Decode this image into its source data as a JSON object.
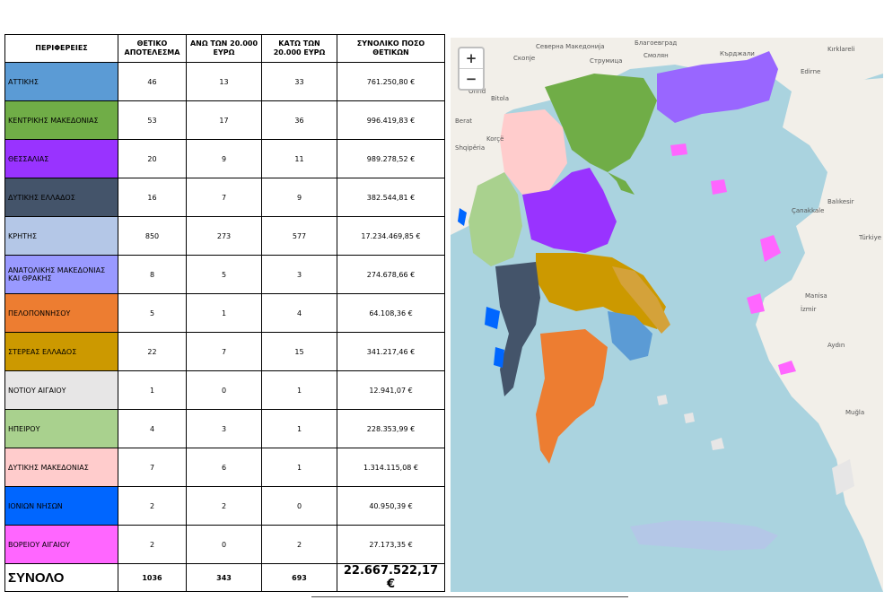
{
  "table": {
    "headers": [
      "ΠΕΡΙΦΕΡΕΙΕΣ",
      "ΘΕΤΙΚΟ ΑΠΟΤΕΛΕΣΜΑ",
      "ΑΝΩ ΤΩΝ 20.000 ΕΥΡΩ",
      "ΚΑΤΩ ΤΩΝ 20.000 ΕΥΡΩ",
      "ΣΥΝΟΛΙΚΟ ΠΟΣΟ ΘΕΤΙΚΩΝ"
    ],
    "rows": [
      {
        "region": "ΑΤΤΙΚΗΣ",
        "color": "#5b9bd5",
        "positive": "46",
        "above": "13",
        "below": "33",
        "total": "761.250,80 €"
      },
      {
        "region": "ΚΕΝΤΡΙΚΗΣ  ΜΑΚΕΔΟΝΙΑΣ",
        "color": "#70ad47",
        "positive": "53",
        "above": "17",
        "below": "36",
        "total": "996.419,83 €"
      },
      {
        "region": "ΘΕΣΣΑΛΙΑΣ",
        "color": "#9933ff",
        "positive": "20",
        "above": "9",
        "below": "11",
        "total": "989.278,52 €"
      },
      {
        "region": "ΔΥΤΙΚΗΣ ΕΛΛΑΔΟΣ",
        "color": "#44546a",
        "positive": "16",
        "above": "7",
        "below": "9",
        "total": "382.544,81 €"
      },
      {
        "region": "ΚΡΗΤΗΣ",
        "color": "#b4c7e7",
        "positive": "850",
        "above": "273",
        "below": "577",
        "total": "17.234.469,85 €"
      },
      {
        "region": "ΑΝΑΤΟΛΙΚΗΣ ΜΑΚΕΔΟΝΙΑΣ ΚΑΙ ΘΡΑΚΗΣ",
        "color": "#9999ff",
        "positive": "8",
        "above": "5",
        "below": "3",
        "total": "274.678,66 €"
      },
      {
        "region": "ΠΕΛΟΠΟΝΝΗΣΟΥ",
        "color": "#ed7d31",
        "positive": "5",
        "above": "1",
        "below": "4",
        "total": "64.108,36 €"
      },
      {
        "region": "ΣΤΕΡΕΑΣ ΕΛΛΑΔΟΣ",
        "color": "#cc9900",
        "positive": "22",
        "above": "7",
        "below": "15",
        "total": "341.217,46 €"
      },
      {
        "region": "ΝΟΤΙΟΥ ΑΙΓΑΙΟΥ",
        "color": "#e7e6e6",
        "positive": "1",
        "above": "0",
        "below": "1",
        "total": "12.941,07 €"
      },
      {
        "region": "ΗΠΕΙΡΟΥ",
        "color": "#a9d18e",
        "positive": "4",
        "above": "3",
        "below": "1",
        "total": "228.353,99 €"
      },
      {
        "region": "ΔΥΤΙΚΗΣ ΜΑΚΕΔΟΝΙΑΣ",
        "color": "#ffcccc",
        "positive": "7",
        "above": "6",
        "below": "1",
        "total": "1.314.115,08 €"
      },
      {
        "region": "ΙΟΝΙΩΝ ΝΗΣΩΝ",
        "color": "#0066ff",
        "positive": "2",
        "above": "2",
        "below": "0",
        "total": "40.950,39 €"
      },
      {
        "region": "ΒΟΡΕΙΟΥ ΑΙΓΑΙΟΥ",
        "color": "#ff66ff",
        "positive": "2",
        "above": "0",
        "below": "2",
        "total": "27.173,35 €"
      }
    ],
    "total": {
      "label": "ΣΥΝΟΛΟ",
      "positive": "1036",
      "above": "343",
      "below": "693",
      "total": "22.667.522,17 €"
    }
  },
  "map": {
    "zoom_in": "+",
    "zoom_out": "−",
    "labels": [
      "Северна Македонија",
      "Скопје",
      "Струмица",
      "Благоевград",
      "Смолян",
      "Кърджали",
      "Edirne",
      "Kırklareli",
      "Ohrid",
      "Bitola",
      "Korçë",
      "Berat",
      "Shqipëria",
      "Çanakkale",
      "Balıkesir",
      "Manisa",
      "İzmir",
      "Aydın",
      "Muğla",
      "Türkiye"
    ]
  }
}
